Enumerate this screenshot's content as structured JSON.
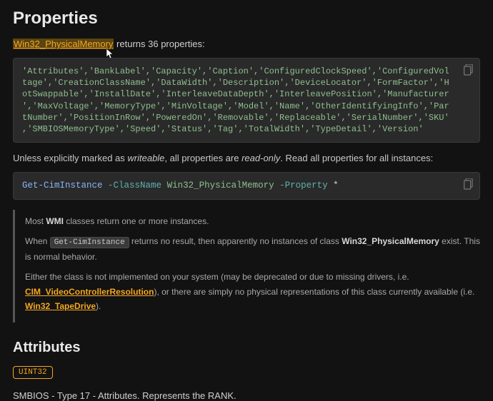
{
  "heading": "Properties",
  "intro": {
    "link_text": "Win32_PhysicalMemory",
    "after_link": " returns 36 properties:"
  },
  "properties_list": "'Attributes','BankLabel','Capacity','Caption','ConfiguredClockSpeed','ConfiguredVoltage','CreationClassName','DataWidth','Description','DeviceLocator','FormFactor','HotSwappable','InstallDate','InterleaveDataDepth','InterleavePosition','Manufacturer','MaxVoltage','MemoryType','MinVoltage','Model','Name','OtherIdentifyingInfo','PartNumber','PositionInRow','PoweredOn','Removable','Replaceable','SerialNumber','SKU','SMBIOSMemoryType','Speed','Status','Tag','TotalWidth','TypeDetail','Version'",
  "readonly_note": {
    "pre": "Unless explicitly marked as ",
    "em1": "writeable",
    "mid": ", all properties are ",
    "em2": "read-only",
    "post": ". Read all properties for all instances:"
  },
  "command": {
    "cmdlet": "Get-CimInstance",
    "param1": "-ClassName",
    "value1": "Win32_PhysicalMemory",
    "param2": "-Property",
    "star": "*"
  },
  "note": {
    "line1_pre": "Most ",
    "line1_strong": "WMI",
    "line1_post": " classes return one or more instances.",
    "line2_pre": "When ",
    "line2_code": "Get-CimInstance",
    "line2_mid": " returns no result, then apparently no instances of class ",
    "line2_strong": "Win32_PhysicalMemory",
    "line2_post": " exist. This is normal behavior.",
    "line3_pre": "Either the class is not implemented on your system (may be deprecated or due to missing drivers, i.e. ",
    "line3_link1": "CIM_VideoControllerResolution",
    "line3_mid": "), or there are simply no physical representations of this class currently available (i.e. ",
    "line3_link2": "Win32_TapeDrive",
    "line3_post": ")."
  },
  "attributes": {
    "heading": "Attributes",
    "type": "UINT32",
    "description": "SMBIOS - Type 17 - Attributes. Represents the RANK."
  }
}
